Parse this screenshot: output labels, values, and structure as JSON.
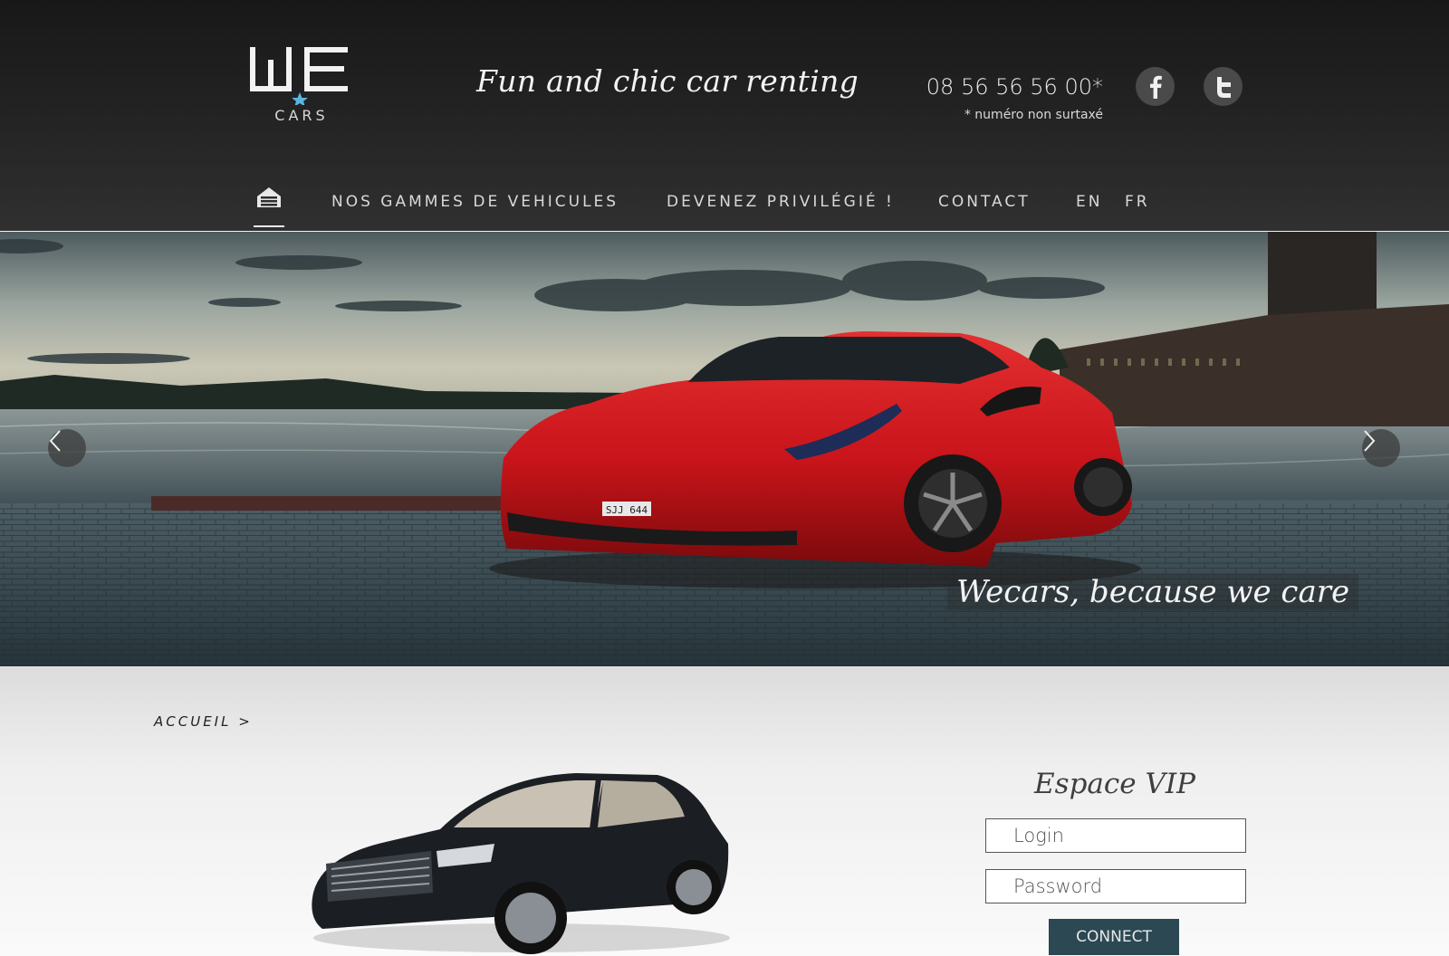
{
  "header": {
    "logo_cars": "CARS",
    "tagline": "Fun and chic car renting",
    "phone": "08 56 56 56 00*",
    "phone_note": "* numéro non surtaxé"
  },
  "nav": {
    "items": [
      {
        "label": "NOS GAMMES DE VEHICULES"
      },
      {
        "label": "DEVENEZ PRIVILÉGIÉ !"
      },
      {
        "label": "CONTACT"
      },
      {
        "label": "EN"
      },
      {
        "label": "FR"
      }
    ]
  },
  "hero": {
    "slogan": "Wecars, because we care",
    "plate": "SJJ 644"
  },
  "breadcrumb": "ACCUEIL >",
  "vip": {
    "title": "Espace VIP",
    "login_placeholder": "Login",
    "password_placeholder": "Password",
    "connect_label": "CONNECT"
  },
  "colors": {
    "accent_star": "#5bb4e0",
    "connect_button": "#2b4853",
    "car_red": "#c8141a"
  }
}
